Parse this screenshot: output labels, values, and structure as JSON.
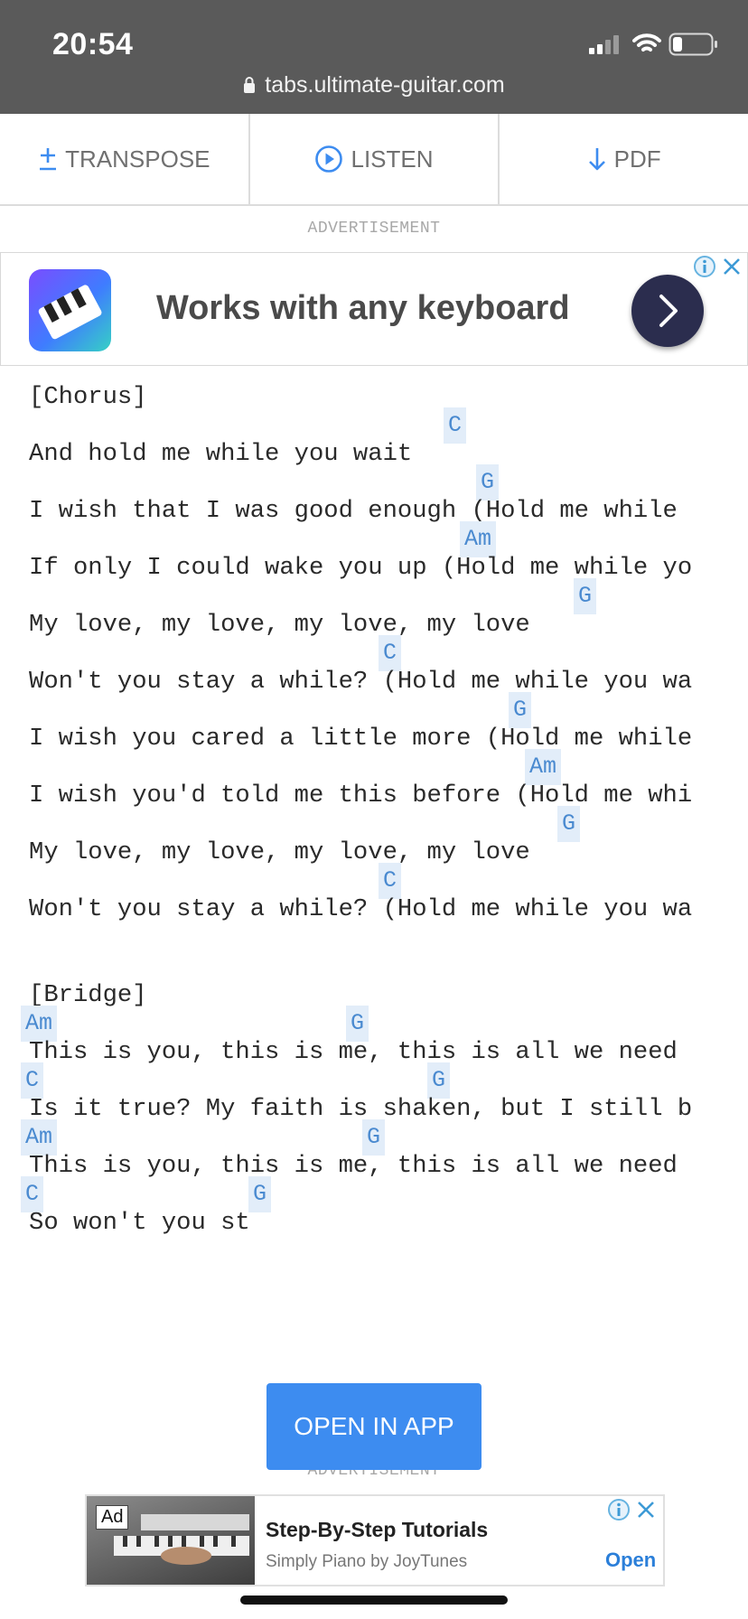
{
  "status_bar": {
    "time": "20:54",
    "url": "tabs.ultimate-guitar.com",
    "icons": [
      "signal-icon",
      "wifi-icon",
      "battery-icon",
      "lock-icon"
    ]
  },
  "toolbar": {
    "transpose_label": "TRANSPOSE",
    "listen_label": "LISTEN",
    "pdf_label": "PDF",
    "accent_color": "#3d8cf0"
  },
  "ad_top": {
    "label": "ADVERTISEMENT",
    "headline": "Works with any keyboard"
  },
  "song": {
    "lines": [
      "[Chorus]",
      "And hold me while you wait",
      "I wish that I was good enough (Hold me while",
      "If only I could wake you up (Hold me while yo",
      "My love, my love, my love, my love",
      "Won't you stay a while? (Hold me while you wa",
      "I wish you cared a little more (Hold me while",
      "I wish you'd told me this before (Hold me whi",
      "My love, my love, my love, my love",
      "Won't you stay a while? (Hold me while you wa",
      "[Bridge]",
      "This is you, this is me, this is all we need",
      "Is it true? My faith is shaken, but I still b",
      "This is you, this is me, this is all we need",
      "So won't you st"
    ],
    "chords": [
      "C",
      "G",
      "Am",
      "G",
      "C",
      "G",
      "Am",
      "G",
      "C",
      "Am",
      "G",
      "C",
      "G",
      "Am",
      "G",
      "C",
      "G"
    ],
    "chord_color": "#4a8ad0"
  },
  "open_in_app_label": "OPEN IN APP",
  "ad_bottom": {
    "label": "ADVERTISEMENT",
    "badge": "Ad",
    "title": "Step-By-Step Tutorials",
    "subtitle": "Simply Piano by JoyTunes",
    "cta": "Open"
  }
}
